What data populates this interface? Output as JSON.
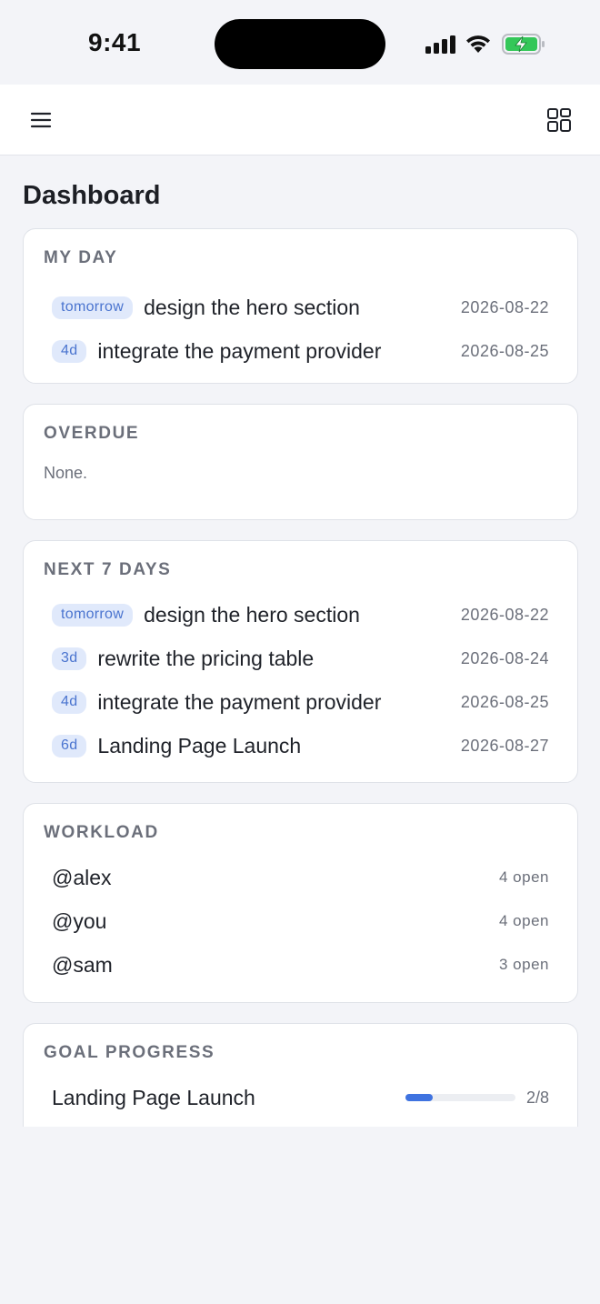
{
  "status_bar": {
    "time": "9:41"
  },
  "page": {
    "title": "Dashboard"
  },
  "icons": {
    "menu": "menu-icon",
    "layout": "grid-layout-icon"
  },
  "colors": {
    "accent": "#3f73e0",
    "badge_bg": "#e0e9fb",
    "badge_text": "#4a74cf",
    "background": "#f3f4f8"
  },
  "my_day": {
    "title": "MY DAY",
    "items": [
      {
        "badge": "tomorrow",
        "text": "design the hero section",
        "date": "2026-08-22"
      },
      {
        "badge": "4d",
        "text": "integrate the payment provider",
        "date": "2026-08-25"
      }
    ]
  },
  "overdue": {
    "title": "OVERDUE",
    "empty_text": "None."
  },
  "next7": {
    "title": "NEXT 7 DAYS",
    "items": [
      {
        "badge": "tomorrow",
        "text": "design the hero section",
        "date": "2026-08-22"
      },
      {
        "badge": "3d",
        "text": "rewrite the pricing table",
        "date": "2026-08-24"
      },
      {
        "badge": "4d",
        "text": "integrate the payment provider",
        "date": "2026-08-25"
      },
      {
        "badge": "6d",
        "text": "Landing Page Launch",
        "date": "2026-08-27"
      }
    ]
  },
  "workload": {
    "title": "WORKLOAD",
    "items": [
      {
        "name": "@alex",
        "count": "4 open"
      },
      {
        "name": "@you",
        "count": "4 open"
      },
      {
        "name": "@sam",
        "count": "3 open"
      }
    ]
  },
  "goal_progress": {
    "title": "GOAL PROGRESS",
    "items": [
      {
        "name": "Landing Page Launch",
        "progress": "2/8",
        "fraction": 0.25
      }
    ]
  }
}
